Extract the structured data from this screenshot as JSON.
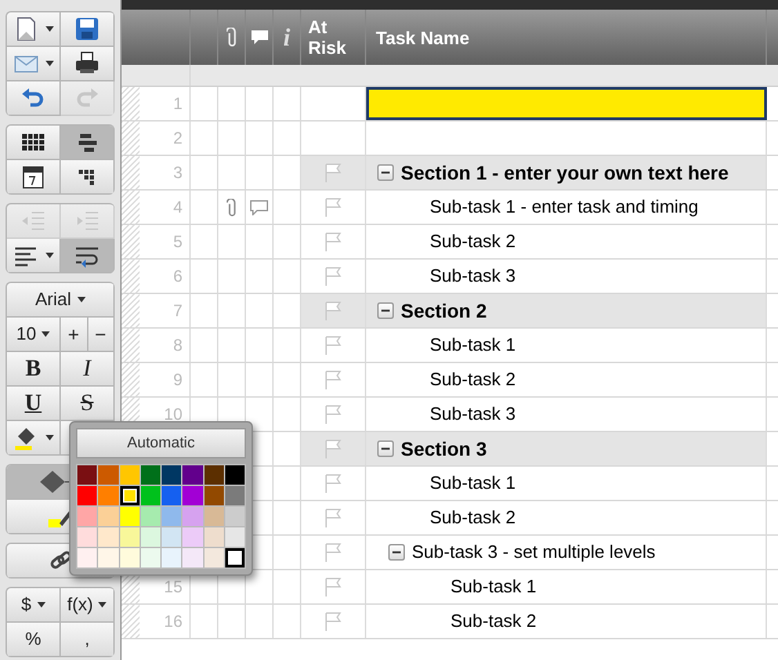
{
  "toolbar": [
    [
      {
        "kind": "new",
        "caret": true,
        "selected": false,
        "disabled": false
      },
      {
        "kind": "save",
        "caret": false,
        "selected": false,
        "disabled": false
      },
      {
        "kind": "mail",
        "caret": true,
        "selected": false,
        "disabled": false
      },
      {
        "kind": "print",
        "caret": false,
        "selected": false,
        "disabled": false
      },
      {
        "kind": "undo",
        "caret": false,
        "selected": false,
        "disabled": false
      },
      {
        "kind": "redo",
        "caret": false,
        "selected": false,
        "disabled": true
      }
    ],
    [
      {
        "kind": "grid",
        "caret": false,
        "selected": false,
        "disabled": false
      },
      {
        "kind": "gantt",
        "caret": false,
        "selected": true,
        "disabled": false
      },
      {
        "kind": "calendar",
        "caret": false,
        "selected": false,
        "disabled": false
      },
      {
        "kind": "cards",
        "caret": false,
        "selected": false,
        "disabled": false
      }
    ],
    [
      {
        "kind": "outdent",
        "caret": false,
        "selected": false,
        "disabled": true
      },
      {
        "kind": "indent",
        "caret": false,
        "selected": false,
        "disabled": true
      },
      {
        "kind": "align",
        "caret": true,
        "selected": false,
        "disabled": false
      },
      {
        "kind": "wrap",
        "caret": false,
        "selected": true,
        "disabled": false
      }
    ],
    [
      {
        "kind": "font",
        "label": "Arial",
        "caret": true,
        "selected": false,
        "disabled": false
      },
      {
        "kind": "fontsize",
        "label": "10",
        "caret": true,
        "selected": false,
        "disabled": false
      },
      {
        "kind": "step",
        "label": "+",
        "caret": false,
        "selected": false,
        "disabled": false
      },
      {
        "kind": "step",
        "label": "−",
        "caret": false,
        "selected": false,
        "disabled": false
      },
      {
        "kind": "bold",
        "label": "B",
        "caret": false,
        "selected": false,
        "disabled": false
      },
      {
        "kind": "italic",
        "label": "I",
        "caret": false,
        "selected": false,
        "disabled": false
      },
      {
        "kind": "underline",
        "label": "U",
        "caret": false,
        "selected": false,
        "disabled": false
      },
      {
        "kind": "strike",
        "label": "S",
        "caret": false,
        "selected": false,
        "disabled": false
      },
      {
        "kind": "fill",
        "caret": true,
        "selected": false,
        "disabled": false
      },
      {
        "kind": "blank",
        "caret": false,
        "selected": false,
        "disabled": false
      }
    ],
    [
      {
        "kind": "dependency",
        "caret": false,
        "selected": true,
        "disabled": false
      },
      {
        "kind": "highlight",
        "caret": false,
        "selected": false,
        "disabled": false
      }
    ],
    [
      {
        "kind": "link",
        "caret": false,
        "selected": false,
        "disabled": false
      }
    ],
    [
      {
        "kind": "text",
        "label": "$",
        "caret": true,
        "selected": false,
        "disabled": false
      },
      {
        "kind": "text",
        "label": "f(x)",
        "caret": true,
        "selected": false,
        "disabled": false
      },
      {
        "kind": "text",
        "label": "%",
        "caret": false,
        "selected": false,
        "disabled": false
      },
      {
        "kind": "text",
        "label": ",",
        "caret": false,
        "selected": false,
        "disabled": false
      }
    ]
  ],
  "columns": {
    "info": "i",
    "at_risk": "At Risk",
    "task_name": "Task Name"
  },
  "rows": [
    {
      "number": "1",
      "selected": true,
      "color": "#ffea00"
    },
    {
      "number": "2",
      "selected": false
    },
    {
      "number": "3",
      "selected": false,
      "section": true,
      "task": "Section 1 - enter your own text here",
      "expanded": true,
      "children": [
        {
          "number": "4",
          "selected": false,
          "task": "Sub-task 1 - enter task and timing",
          "attachment": true,
          "comment": true
        },
        {
          "number": "5",
          "selected": false,
          "task": "Sub-task 2"
        },
        {
          "number": "6",
          "selected": false,
          "task": "Sub-task 3"
        }
      ]
    },
    {
      "number": "7",
      "selected": false,
      "section": true,
      "task": "Section 2",
      "expanded": true,
      "children": [
        {
          "number": "8",
          "selected": false,
          "task": "Sub-task 1"
        },
        {
          "number": "9",
          "selected": false,
          "task": "Sub-task 2"
        },
        {
          "number": "10",
          "selected": false,
          "task": "Sub-task 3"
        }
      ]
    },
    {
      "selected": false,
      "section": true,
      "task": "Section 3",
      "expanded": true,
      "children": [
        {
          "selected": false,
          "task": "Sub-task 1"
        },
        {
          "selected": false,
          "task": "Sub-task 2"
        },
        {
          "selected": false,
          "task": "Sub-task 3 - set multiple levels",
          "expanded": true,
          "children": [
            {
              "number": "15",
              "selected": false,
              "task": "Sub-task 1"
            },
            {
              "number": "16",
              "selected": false,
              "task": "Sub-task 2"
            }
          ]
        }
      ]
    }
  ],
  "color_menu": {
    "automatic": "Automatic",
    "swatches": [
      [
        {
          "color": "#7a0f12",
          "selected": false
        },
        {
          "color": "#cc5a00",
          "selected": false
        },
        {
          "color": "#ffc600",
          "selected": false
        },
        {
          "color": "#00701a",
          "selected": false
        },
        {
          "color": "#003763",
          "selected": false
        },
        {
          "color": "#62008c",
          "selected": false
        },
        {
          "color": "#5c2f00",
          "selected": false
        },
        {
          "color": "#000000",
          "selected": false
        }
      ],
      [
        {
          "color": "#ff0000",
          "selected": false
        },
        {
          "color": "#ff7f00",
          "selected": false
        },
        {
          "color": "#ffe100",
          "selected": true
        },
        {
          "color": "#00c11c",
          "selected": false
        },
        {
          "color": "#1560f0",
          "selected": false
        },
        {
          "color": "#a200d5",
          "selected": false
        },
        {
          "color": "#924900",
          "selected": false
        },
        {
          "color": "#7b7b7b",
          "selected": false
        }
      ],
      [
        {
          "color": "#ffa6a6",
          "selected": false
        },
        {
          "color": "#fbd097",
          "selected": false
        },
        {
          "color": "#ffff00",
          "selected": false
        },
        {
          "color": "#a6ebae",
          "selected": false
        },
        {
          "color": "#8fb9ec",
          "selected": false
        },
        {
          "color": "#d6a2ef",
          "selected": false
        },
        {
          "color": "#d8b996",
          "selected": false
        },
        {
          "color": "#cccccc",
          "selected": false
        }
      ],
      [
        {
          "color": "#ffdcdc",
          "selected": false
        },
        {
          "color": "#ffe8cb",
          "selected": false
        },
        {
          "color": "#f8f79a",
          "selected": false
        },
        {
          "color": "#dcf7df",
          "selected": false
        },
        {
          "color": "#d2e5f3",
          "selected": false
        },
        {
          "color": "#eccbf8",
          "selected": false
        },
        {
          "color": "#eeddcd",
          "selected": false
        },
        {
          "color": "#e6e6e6",
          "selected": false
        }
      ],
      [
        {
          "color": "#fff0f0",
          "selected": false
        },
        {
          "color": "#fff6e8",
          "selected": false
        },
        {
          "color": "#fffbdc",
          "selected": false
        },
        {
          "color": "#ecfaee",
          "selected": false
        },
        {
          "color": "#e8f3fc",
          "selected": false
        },
        {
          "color": "#f4e8f8",
          "selected": false
        },
        {
          "color": "#f3e8dd",
          "selected": false
        },
        {
          "color": "#ffffff",
          "selected": true
        }
      ]
    ]
  }
}
